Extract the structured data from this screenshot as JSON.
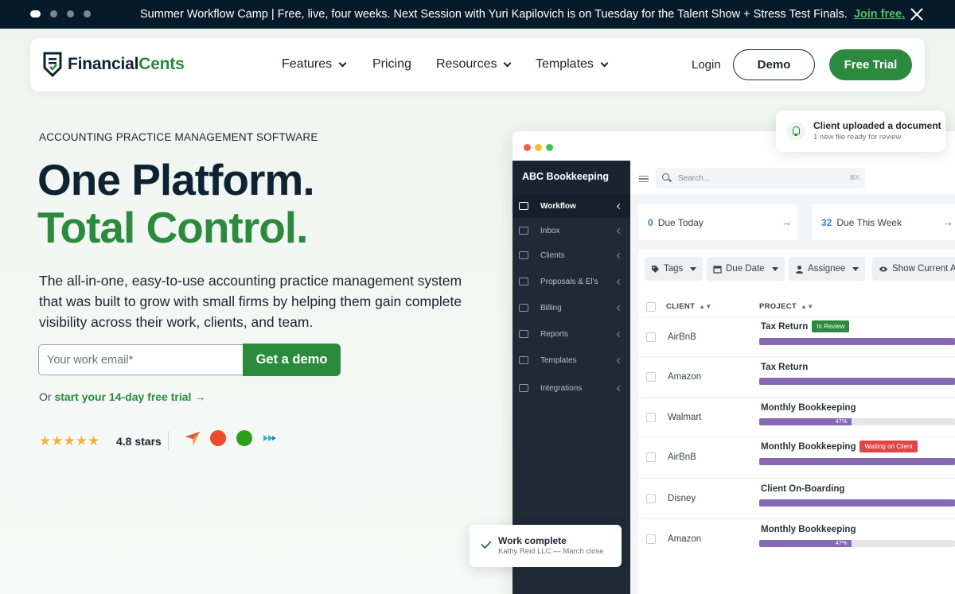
{
  "announcement": {
    "text": "Summer Workflow Camp | Free, live, four weeks. Next Session with Yuri Kapilovich is on Tuesday for the Talent Show + Stress Test Finals.",
    "link_label": "Join free."
  },
  "nav": {
    "logo_primary": "Financial",
    "logo_accent": "Cents",
    "items": [
      "Features",
      "Pricing",
      "Resources",
      "Templates"
    ],
    "login_label": "Login",
    "demo_label": "Demo",
    "trial_label": "Free Trial"
  },
  "hero": {
    "eyebrow": "ACCOUNTING PRACTICE MANAGEMENT SOFTWARE",
    "headline_1": "One Platform.",
    "headline_2": "Total Control.",
    "lead": "The all-in-one, easy-to-use accounting practice management system that was built to grow with small firms by helping them gain complete visibility across their work, clients, and team.",
    "email_placeholder": "Your work email*",
    "cta_label": "Get a demo",
    "trial_prefix": "Or ",
    "trial_link": "start your 14-day free trial",
    "stars": "★★★★★",
    "rating_label": "4.8 stars"
  },
  "app": {
    "firm_name": "ABC Bookkeeping",
    "sidebar": [
      {
        "label": "Workflow",
        "active": true
      },
      {
        "label": "Inbox",
        "active": false
      },
      {
        "label": "Clients",
        "active": false
      },
      {
        "label": "Proposals & El's",
        "active": false
      },
      {
        "label": "Billing",
        "active": false
      },
      {
        "label": "Reports",
        "active": false
      },
      {
        "label": "Templates",
        "active": false
      },
      {
        "label": "Integrations",
        "active": false
      }
    ],
    "search_placeholder": "Search...",
    "search_shortcut": "⌘K",
    "stats": [
      {
        "count": "0",
        "label": "Due Today"
      },
      {
        "count": "32",
        "label": "Due This Week"
      }
    ],
    "filters": [
      "Tags",
      "Due Date",
      "Assignee",
      "Show Current Ac"
    ],
    "columns": [
      "CLIENT",
      "PROJECT"
    ],
    "rows": [
      {
        "client": "AirBnB",
        "project": "Tax Return",
        "tag": "In Review",
        "progress": 100,
        "pct_label": ""
      },
      {
        "client": "Amazon",
        "project": "Tax Return",
        "tag": "",
        "progress": 100,
        "pct_label": ""
      },
      {
        "client": "Walmart",
        "project": "Monthly Bookkeeping",
        "tag": "",
        "progress": 47,
        "pct_label": "47%"
      },
      {
        "client": "AirBnB",
        "project": "Monthly Bookkeeping",
        "tag": "Waiting on Client",
        "progress": 100,
        "pct_label": ""
      },
      {
        "client": "Disney",
        "project": "Client On-Boarding",
        "tag": "",
        "progress": 100,
        "pct_label": ""
      },
      {
        "client": "Amazon",
        "project": "Monthly Bookkeeping",
        "tag": "",
        "progress": 47,
        "pct_label": "47%"
      }
    ]
  },
  "notification": {
    "title": "Client uploaded a document",
    "subtitle": "1 new file ready for review"
  },
  "complete_card": {
    "title": "Work complete",
    "subtitle": "Kathy Reid LLC — March close"
  },
  "colors": {
    "brand_green": "#2b8a3e",
    "navy": "#071a2a",
    "progress_purple": "#8569b5",
    "tag_in_review": "#2b8a3e",
    "tag_waiting": "#e04545"
  }
}
